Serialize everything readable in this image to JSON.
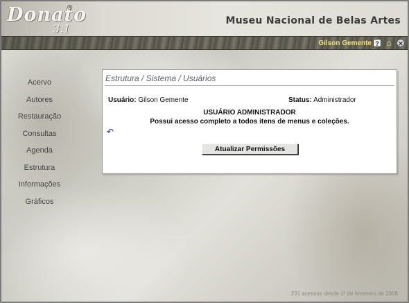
{
  "header": {
    "logo_text": "Donato",
    "logo_registered": "®",
    "logo_version": "3.1",
    "museum_title": "Museu Nacional de Belas Artes"
  },
  "userbar": {
    "user_name": "Gilson Gemente",
    "help_icon": "?",
    "home_icon": "⌂",
    "close_icon": "✕"
  },
  "sidebar": {
    "items": [
      {
        "label": "Acervo"
      },
      {
        "label": "Autores"
      },
      {
        "label": "Restauração"
      },
      {
        "label": "Consultas"
      },
      {
        "label": "Agenda"
      },
      {
        "label": "Estrutura"
      },
      {
        "label": "Informações"
      },
      {
        "label": "Gráficos"
      }
    ]
  },
  "panel": {
    "breadcrumb": "Estrutura / Sistema / Usuários",
    "user_label": "Usuário:",
    "user_value": "Gilson Gemente",
    "status_label": "Status:",
    "status_value": "Administrador",
    "role_heading": "USUÁRIO ADMINISTRADOR",
    "role_description": "Possui acesso completo a todos itens de menus e coleções.",
    "back_icon": "↶",
    "update_button_label": "Atualizar Permissões"
  },
  "footer": {
    "text": "231 acessos desde 1º de fevereiro de 2008"
  },
  "colors": {
    "user_name": "#f3e07a",
    "panel_title": "#5a5f6e",
    "back_icon": "#1a2fb0"
  }
}
